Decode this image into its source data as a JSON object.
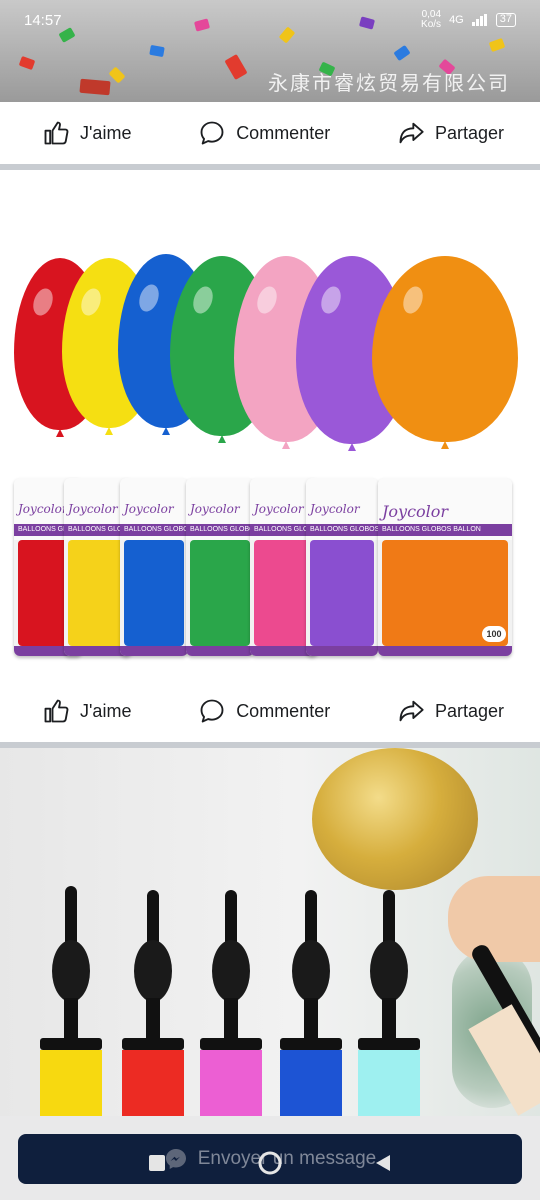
{
  "status_bar": {
    "time": "14:57",
    "net_rate_value": "0,04",
    "net_rate_unit": "Ko/s",
    "network": "4G",
    "battery": "37"
  },
  "banner": {
    "watermark": "永康市睿炫贸易有限公司"
  },
  "action_bars": [
    {
      "like_label": "J'aime",
      "comment_label": "Commenter",
      "share_label": "Partager"
    },
    {
      "like_label": "J'aime",
      "comment_label": "Commenter",
      "share_label": "Partager"
    }
  ],
  "balloons_post": {
    "brand": "Joycolor",
    "band_text": "BALLOONS GLOBOS BALLON",
    "pack_count": "100",
    "colors": [
      "#d8141f",
      "#f5df12",
      "#1560d0",
      "#2aa64a",
      "#f3a4c2",
      "#9a58d8",
      "#f08f12"
    ]
  },
  "message_bar": {
    "label": "Envoyer un message"
  },
  "icons": {
    "like": "thumbs-up-icon",
    "comment": "comment-bubble-icon",
    "share": "share-arrow-icon",
    "messenger": "messenger-icon"
  }
}
